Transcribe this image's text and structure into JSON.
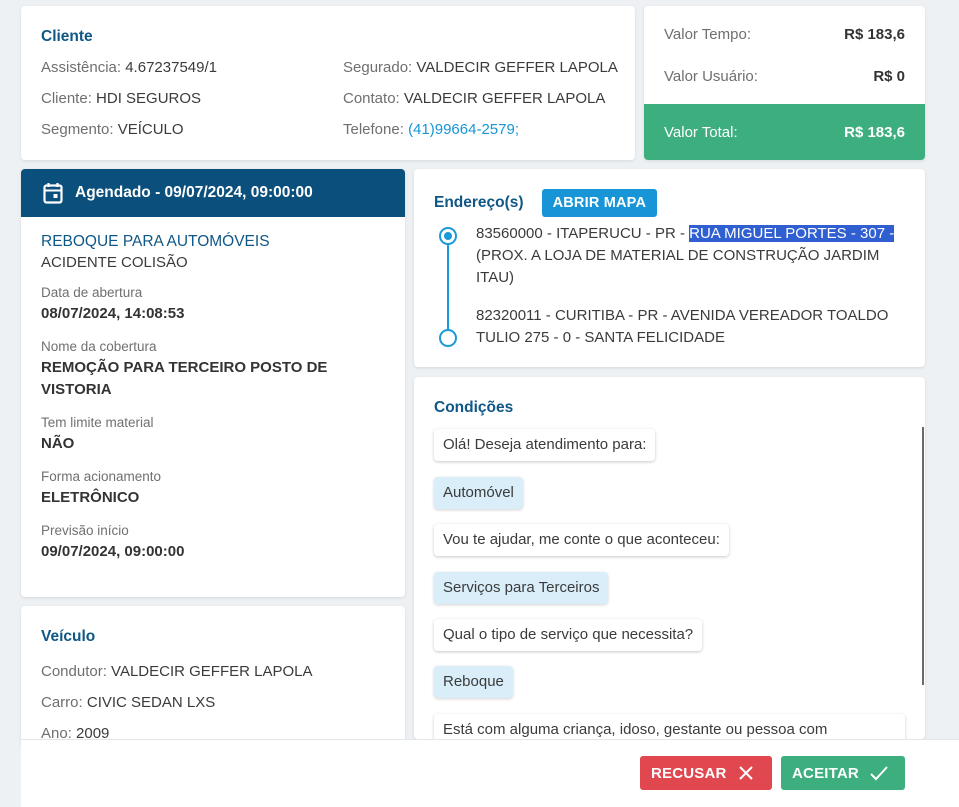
{
  "client": {
    "title": "Cliente",
    "assistencia_label": "Assistência:",
    "assistencia_value": "4.67237549/1",
    "cliente_label": "Cliente:",
    "cliente_value": "HDI SEGUROS",
    "segmento_label": "Segmento:",
    "segmento_value": "VEÍCULO",
    "segurado_label": "Segurado:",
    "segurado_value": "VALDECIR GEFFER LAPOLA",
    "contato_label": "Contato:",
    "contato_value": "VALDECIR GEFFER LAPOLA",
    "telefone_label": "Telefone:",
    "telefone_value": "(41)99664-2579;"
  },
  "values": {
    "tempo_label": "Valor Tempo:",
    "tempo_value": "R$ 183,6",
    "usuario_label": "Valor Usuário:",
    "usuario_value": "R$ 0",
    "total_label": "Valor Total:",
    "total_value": "R$ 183,6",
    "total_color": "#3daf7e"
  },
  "schedule": {
    "header": "Agendado - 09/07/2024, 09:00:00",
    "header_icon": "calendar-icon",
    "service_title": "REBOQUE PARA AUTOMÓVEIS",
    "service_sub": "ACIDENTE COLISÃO",
    "fields": [
      {
        "label": "Data de abertura",
        "value": "08/07/2024, 14:08:53"
      },
      {
        "label": "Nome da cobertura",
        "value": "REMOÇÃO PARA TERCEIRO POSTO DE VISTORIA"
      },
      {
        "label": "Tem limite material",
        "value": "NÃO"
      },
      {
        "label": "Forma acionamento",
        "value": "ELETRÔNICO"
      },
      {
        "label": "Previsão início",
        "value": "09/07/2024, 09:00:00"
      }
    ]
  },
  "vehicle": {
    "title": "Veículo",
    "condutor_label": "Condutor:",
    "condutor_value": "VALDECIR GEFFER LAPOLA",
    "carro_label": "Carro:",
    "carro_value": "CIVIC SEDAN LXS",
    "ano_label": "Ano:",
    "ano_value": "2009"
  },
  "address": {
    "title": "Endereço(s)",
    "map_button": "ABRIR MAPA",
    "origin_prefix": "83560000 - ITAPERUCU - PR - ",
    "origin_highlight": "RUA MIGUEL PORTES - 307 -",
    "origin_suffix": "(PROX. A LOJA DE MATERIAL DE CONSTRUÇÃO JARDIM ITAU)",
    "destination": "82320011 - CURITIBA - PR - AVENIDA VEREADOR TOALDO TULIO 275 - 0 - SANTA FELICIDADE"
  },
  "conditions": {
    "title": "Condições",
    "messages": [
      {
        "role": "bot",
        "text": "Olá! Deseja atendimento para:"
      },
      {
        "role": "user",
        "text": "Automóvel"
      },
      {
        "role": "bot",
        "text": "Vou te ajudar, me conte o que aconteceu:"
      },
      {
        "role": "user",
        "text": "Serviços para Terceiros"
      },
      {
        "role": "bot",
        "text": "Qual o tipo de serviço que necessita?"
      },
      {
        "role": "user",
        "text": "Reboque"
      },
      {
        "role": "bot",
        "text": "Está com alguma criança, idoso, gestante ou pessoa com"
      }
    ]
  },
  "actions": {
    "refuse": "RECUSAR",
    "accept": "ACEITAR"
  }
}
